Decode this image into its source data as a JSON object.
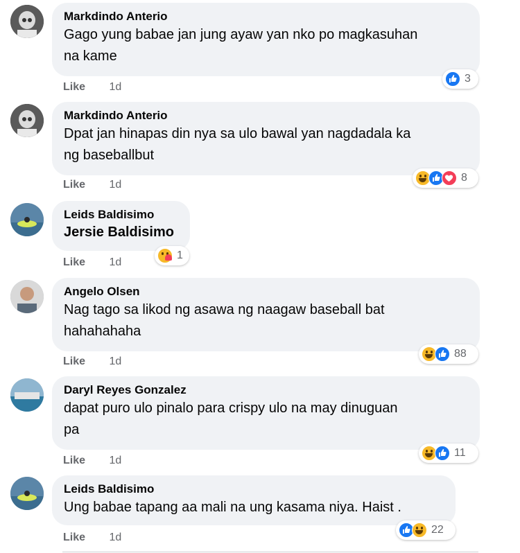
{
  "like_label": "Like",
  "colors": {
    "bubble": "#f0f2f5",
    "meta": "#65676b",
    "like_blue": "#1877f2",
    "haha_yellow": "#f7b928",
    "love_red": "#f33e58"
  },
  "comments": [
    {
      "author": "Markdindo Anterio",
      "lines": [
        "Gago yung babae jan jung ayaw yan nko po magkasuhan",
        "na kame"
      ],
      "time": "1d",
      "reactions": [
        "like-icon"
      ],
      "count": "3"
    },
    {
      "author": "Markdindo Anterio",
      "lines": [
        "Dpat jan hinapas din nya sa ulo bawal yan nagdadala ka",
        "ng baseballbut"
      ],
      "time": "1d",
      "reactions": [
        "haha-icon",
        "like-icon",
        "love-icon"
      ],
      "count": "8"
    },
    {
      "author": "Leids Baldisimo",
      "lines": [
        "Jersie Baldisimo"
      ],
      "time": "1d",
      "reactions": [
        "care-icon"
      ],
      "count": "1"
    },
    {
      "author": "Angelo Olsen",
      "lines": [
        "Nag tago sa likod ng asawa ng naagaw baseball bat",
        "hahahahaha"
      ],
      "time": "1d",
      "reactions": [
        "haha-icon",
        "like-icon"
      ],
      "count": "88"
    },
    {
      "author": "Daryl Reyes Gonzalez",
      "lines": [
        "dapat puro ulo pinalo para crispy ulo na may dinuguan",
        "pa"
      ],
      "time": "1d",
      "reactions": [
        "haha-icon",
        "like-icon"
      ],
      "count": "11"
    },
    {
      "author": "Leids Baldisimo",
      "lines": [
        "Ung babae tapang aa mali na ung kasama niya. Haist ."
      ],
      "time": "1d",
      "reactions": [
        "like-icon",
        "haha-icon"
      ],
      "count": "22"
    }
  ]
}
